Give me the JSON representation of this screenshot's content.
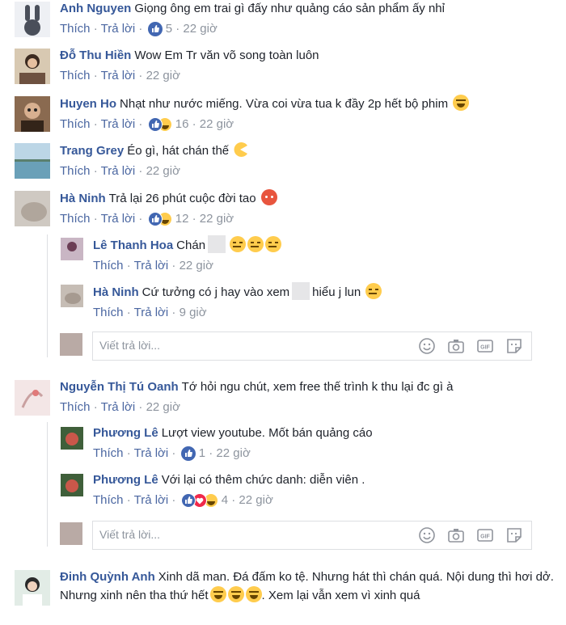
{
  "labels": {
    "like": "Thích",
    "reply": "Trả lời",
    "dot": "·",
    "write_placeholder": "Viết trả lời..."
  },
  "comments": [
    {
      "name": "Anh Nguyen",
      "text": "Giọng ông em trai gì đấy như quảng cáo sản phẩm ấy nhỉ",
      "reactions": "5",
      "time": "22 giờ"
    },
    {
      "name": "Đỗ Thu Hiền",
      "text": "Wow Em Tr văn võ song toàn luôn",
      "time": "22 giờ"
    },
    {
      "name": "Huyen Ho",
      "text": "Nhạt như nước miếng. Vừa coi vừa tua k đầy 2p hết bộ phim",
      "reactions": "16",
      "time": "22 giờ"
    },
    {
      "name": "Trang Grey",
      "text": "Éo gì, hát chán thế",
      "time": "22 giờ"
    },
    {
      "name": "Hà Ninh",
      "text": "Trả lại 26 phút cuộc đời tao",
      "reactions": "12",
      "time": "22 giờ"
    },
    {
      "name": "Lê Thanh Hoa",
      "text": "Chán",
      "time": "22 giờ"
    },
    {
      "name": "Hà Ninh",
      "text_a": "Cứ tưởng có j hay vào xem",
      "text_b": "hiểu j lun",
      "time": "9 giờ"
    },
    {
      "name": "Nguyễn Thị Tú Oanh",
      "text": "Tớ hỏi ngu chút, xem free thế trình k thu lại đc gì à",
      "time": "22 giờ"
    },
    {
      "name": "Phương Lê",
      "text": "Lượt view youtube. Mốt bán quảng cáo",
      "reactions": "1",
      "time": "22 giờ"
    },
    {
      "name": "Phương Lê",
      "text": "Với lại có thêm chức danh: diễn viên .",
      "reactions": "4",
      "time": "22 giờ"
    },
    {
      "name": "Đinh Quỳnh Anh",
      "text_a": "Xinh dã man. Đá đấm ko tệ. Nhưng hát thì chán quá. Nội dung thì hơi dở. Nhưng xinh nên tha thứ hết",
      "text_b": ". Xem lại vẫn xem vì xinh quá"
    }
  ],
  "icons": [
    "like-icon",
    "haha-icon",
    "love-icon",
    "smiley-icon",
    "camera-icon",
    "gif-icon",
    "sticker-icon"
  ],
  "colors": {
    "name": "#365899",
    "link": "#4b67a1",
    "meta": "#8d949e",
    "like_blue": "#4267b2"
  }
}
